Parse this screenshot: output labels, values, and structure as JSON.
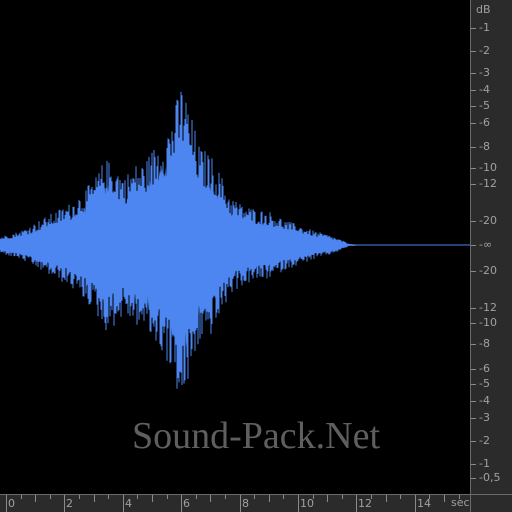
{
  "waveform": {
    "color": "#4d86f0",
    "background": "#000000",
    "centerline_color": "#4d86f0"
  },
  "db_ruler": {
    "unit": "dB",
    "labels_top": [
      "-1",
      "-2",
      "-3",
      "-4",
      "-5",
      "-6",
      "-8",
      "-10",
      "-12",
      "-20"
    ],
    "center_label": "-∞",
    "labels_bottom": [
      "-20",
      "-12",
      "-10",
      "-8",
      "-6",
      "-5",
      "-4",
      "-3",
      "-2",
      "-1",
      "-0,5"
    ]
  },
  "time_ruler": {
    "unit": "sec",
    "labels": [
      "0",
      "2",
      "4",
      "6",
      "8",
      "10",
      "12",
      "14"
    ]
  },
  "watermark": {
    "text": "Sound-Pack.Net"
  }
}
